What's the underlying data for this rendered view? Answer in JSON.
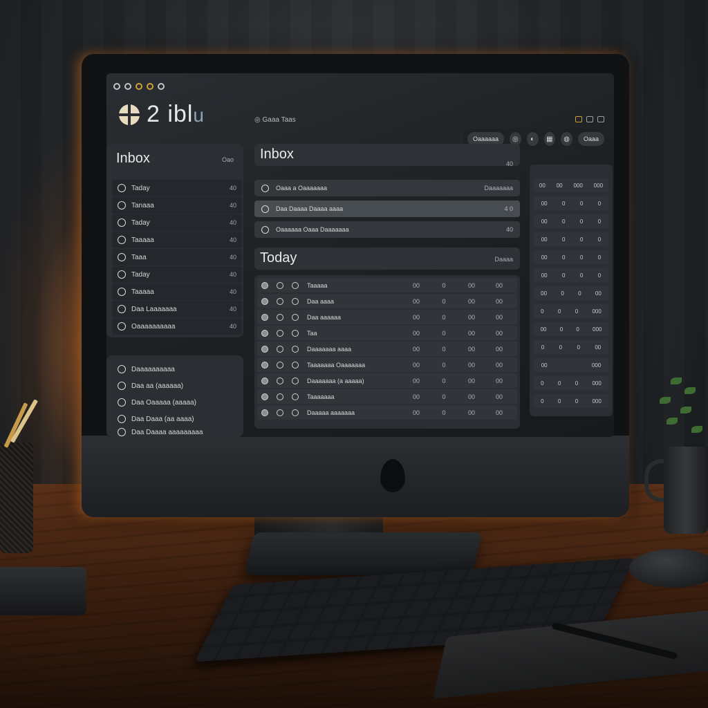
{
  "app": {
    "brand_name": "2 ibl",
    "brand_suffix": "u",
    "header_link": "Gaaa Taas"
  },
  "toolbar": {
    "primary_button": "Oaaaaaa",
    "icon_buttons": [
      "◎",
      "◐",
      "▦",
      "◍"
    ],
    "last_button": "Oaaa"
  },
  "sidebar": {
    "title": "Inbox",
    "count": "Oao",
    "items": [
      {
        "label": "Taday",
        "count": "40"
      },
      {
        "label": "Tanaaa",
        "count": "40"
      },
      {
        "label": "Taday",
        "count": "40"
      },
      {
        "label": "Taaaaa",
        "count": "40"
      },
      {
        "label": "Taaa",
        "count": "40"
      },
      {
        "label": "Taday",
        "count": "40"
      },
      {
        "label": "Taaaaa",
        "count": "40"
      },
      {
        "label": "Daa Laaaaaaa",
        "count": "40"
      },
      {
        "label": "Oaaaaaaaaaa",
        "count": "40"
      }
    ]
  },
  "sidebar_secondary": {
    "items": [
      "Daaaaaaaaaa",
      "Daa aa (aaaaaa)",
      "Daa Oaaaaa (aaaaa)",
      "Daa Daaa (aa aaaa)",
      "Daa Daaaa aaaaaaaaa"
    ]
  },
  "inbox_section": {
    "title": "Inbox",
    "count": "40",
    "rows": [
      {
        "subject": "Oaaa a Oaaaaaaa",
        "meta": "Daaaaaaa"
      },
      {
        "subject": "Daa Daaaa Daaaa aaaa",
        "meta": "4 0"
      },
      {
        "subject": "Oaaaaaa Oaaa Daaaaaaa",
        "meta": "40"
      }
    ]
  },
  "today_section": {
    "title": "Today",
    "count": "Daaaa",
    "rows": [
      {
        "from": "Taaaaa",
        "m1": "00",
        "m2": "0",
        "m3": "00",
        "m4": "00"
      },
      {
        "from": "Daa aaaa",
        "m1": "00",
        "m2": "0",
        "m3": "00",
        "m4": "00"
      },
      {
        "from": "Daa aaaaaa",
        "m1": "00",
        "m2": "0",
        "m3": "00",
        "m4": "00"
      },
      {
        "from": "Taa",
        "m1": "00",
        "m2": "0",
        "m3": "00",
        "m4": "00"
      },
      {
        "from": "Daaaaaaa aaaa",
        "m1": "00",
        "m2": "0",
        "m3": "00",
        "m4": "00"
      },
      {
        "from": "Taaaaaaa Oaaaaaaa",
        "m1": "00",
        "m2": "0",
        "m3": "00",
        "m4": "00"
      },
      {
        "from": "Daaaaaaa (a aaaaa)",
        "m1": "00",
        "m2": "0",
        "m3": "00",
        "m4": "00"
      },
      {
        "from": "Taaaaaaa",
        "m1": "00",
        "m2": "0",
        "m3": "00",
        "m4": "00"
      },
      {
        "from": "Daaaaa aaaaaaa",
        "m1": "00",
        "m2": "0",
        "m3": "00",
        "m4": "00"
      }
    ]
  },
  "right_panel": {
    "rows": [
      [
        "00",
        "00",
        "000",
        "000"
      ],
      [
        "00",
        "0",
        "0",
        "0"
      ],
      [
        "00",
        "0",
        "0",
        "0"
      ],
      [
        "00",
        "0",
        "0",
        "0"
      ],
      [
        "00",
        "0",
        "0",
        "0"
      ],
      [
        "00",
        "0",
        "0",
        "0"
      ],
      [
        "00",
        "0",
        "0",
        "00"
      ],
      [
        "0",
        "0",
        "0",
        "000"
      ],
      [
        "00",
        "0",
        "0",
        "000"
      ],
      [
        "0",
        "0",
        "0",
        "00"
      ],
      [
        "00",
        "",
        "",
        "000"
      ],
      [
        "0",
        "0",
        "0",
        "000"
      ],
      [
        "0",
        "0",
        "0",
        "000"
      ]
    ]
  }
}
